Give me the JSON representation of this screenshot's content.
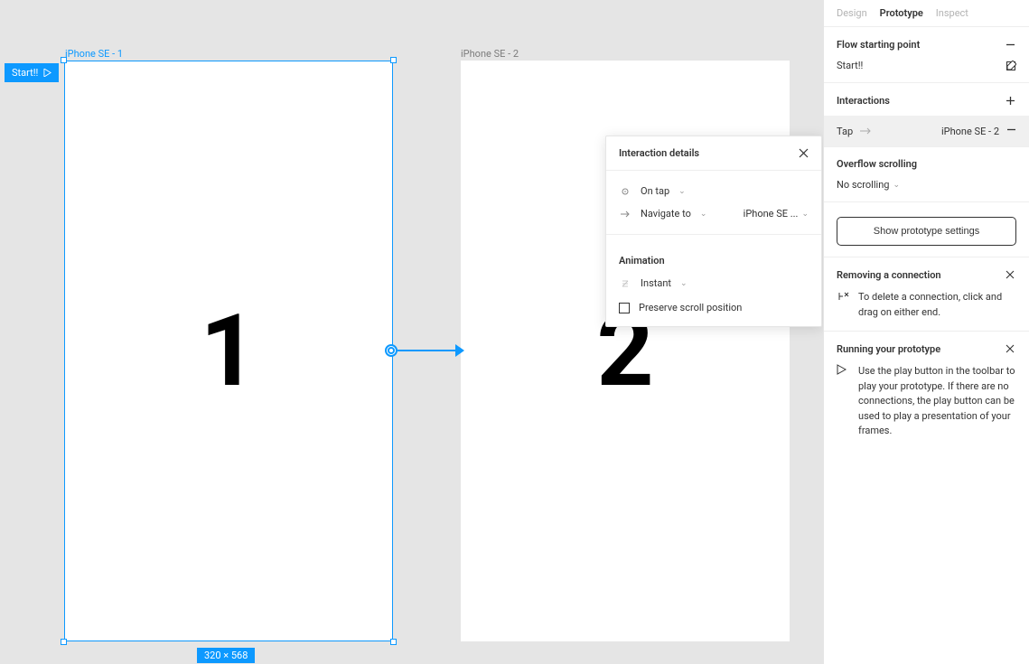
{
  "tabs": {
    "design": "Design",
    "prototype": "Prototype",
    "inspect": "Inspect"
  },
  "canvas": {
    "flow_badge": "Start!!",
    "frame1_label": "iPhone SE - 1",
    "frame2_label": "iPhone SE - 2",
    "frame1_content": "1",
    "frame2_content": "2",
    "size_badge": "320 × 568"
  },
  "popup": {
    "title": "Interaction details",
    "trigger_label": "On tap",
    "action_label": "Navigate to",
    "action_target": "iPhone SE ...",
    "animation_header": "Animation",
    "animation_type": "Instant",
    "preserve_scroll": "Preserve scroll position"
  },
  "panel": {
    "flow_header": "Flow starting point",
    "flow_name": "Start!!",
    "interactions_header": "Interactions",
    "interaction_trigger": "Tap",
    "interaction_target": "iPhone SE - 2",
    "overflow_header": "Overflow scrolling",
    "overflow_value": "No scrolling",
    "proto_settings": "Show prototype settings",
    "removing_header": "Removing a connection",
    "removing_tip": "To delete a connection, click and drag on either end.",
    "running_header": "Running your prototype",
    "running_tip": "Use the play button in the toolbar to play your prototype. If there are no connections, the play button can be used to play a presentation of your frames."
  }
}
